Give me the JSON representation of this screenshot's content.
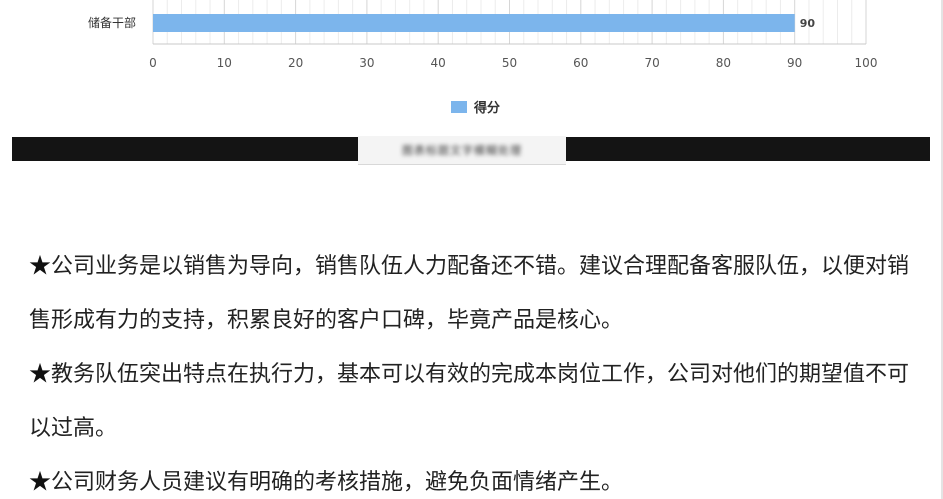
{
  "chart_data": {
    "type": "bar",
    "orientation": "horizontal",
    "categories": [
      "储备干部"
    ],
    "series": [
      {
        "name": "得分",
        "values": [
          90
        ]
      }
    ],
    "xticks": [
      0,
      10,
      20,
      30,
      40,
      50,
      60,
      70,
      80,
      90,
      100
    ],
    "xlim": [
      0,
      100
    ],
    "grid": true,
    "legend": "bottom-center",
    "bar_color": "#7cb5ec"
  },
  "caption": {
    "text": "图表标题文字模糊处理"
  },
  "body": {
    "paragraphs": [
      {
        "star": "★",
        "text": "公司业务是以销售为导向，销售队伍人力配备还不错。建议合理配备客服队伍，以便对销售形成有力的支持，积累良好的客户口碑，毕竟产品是核心。"
      },
      {
        "star": "★",
        "text": "教务队伍突出特点在执行力，基本可以有效的完成本岗位工作，公司对他们的期望值不可以过高。"
      },
      {
        "star": "★",
        "text": "公司财务人员建议有明确的考核措施，避免负面情绪产生。"
      }
    ]
  }
}
